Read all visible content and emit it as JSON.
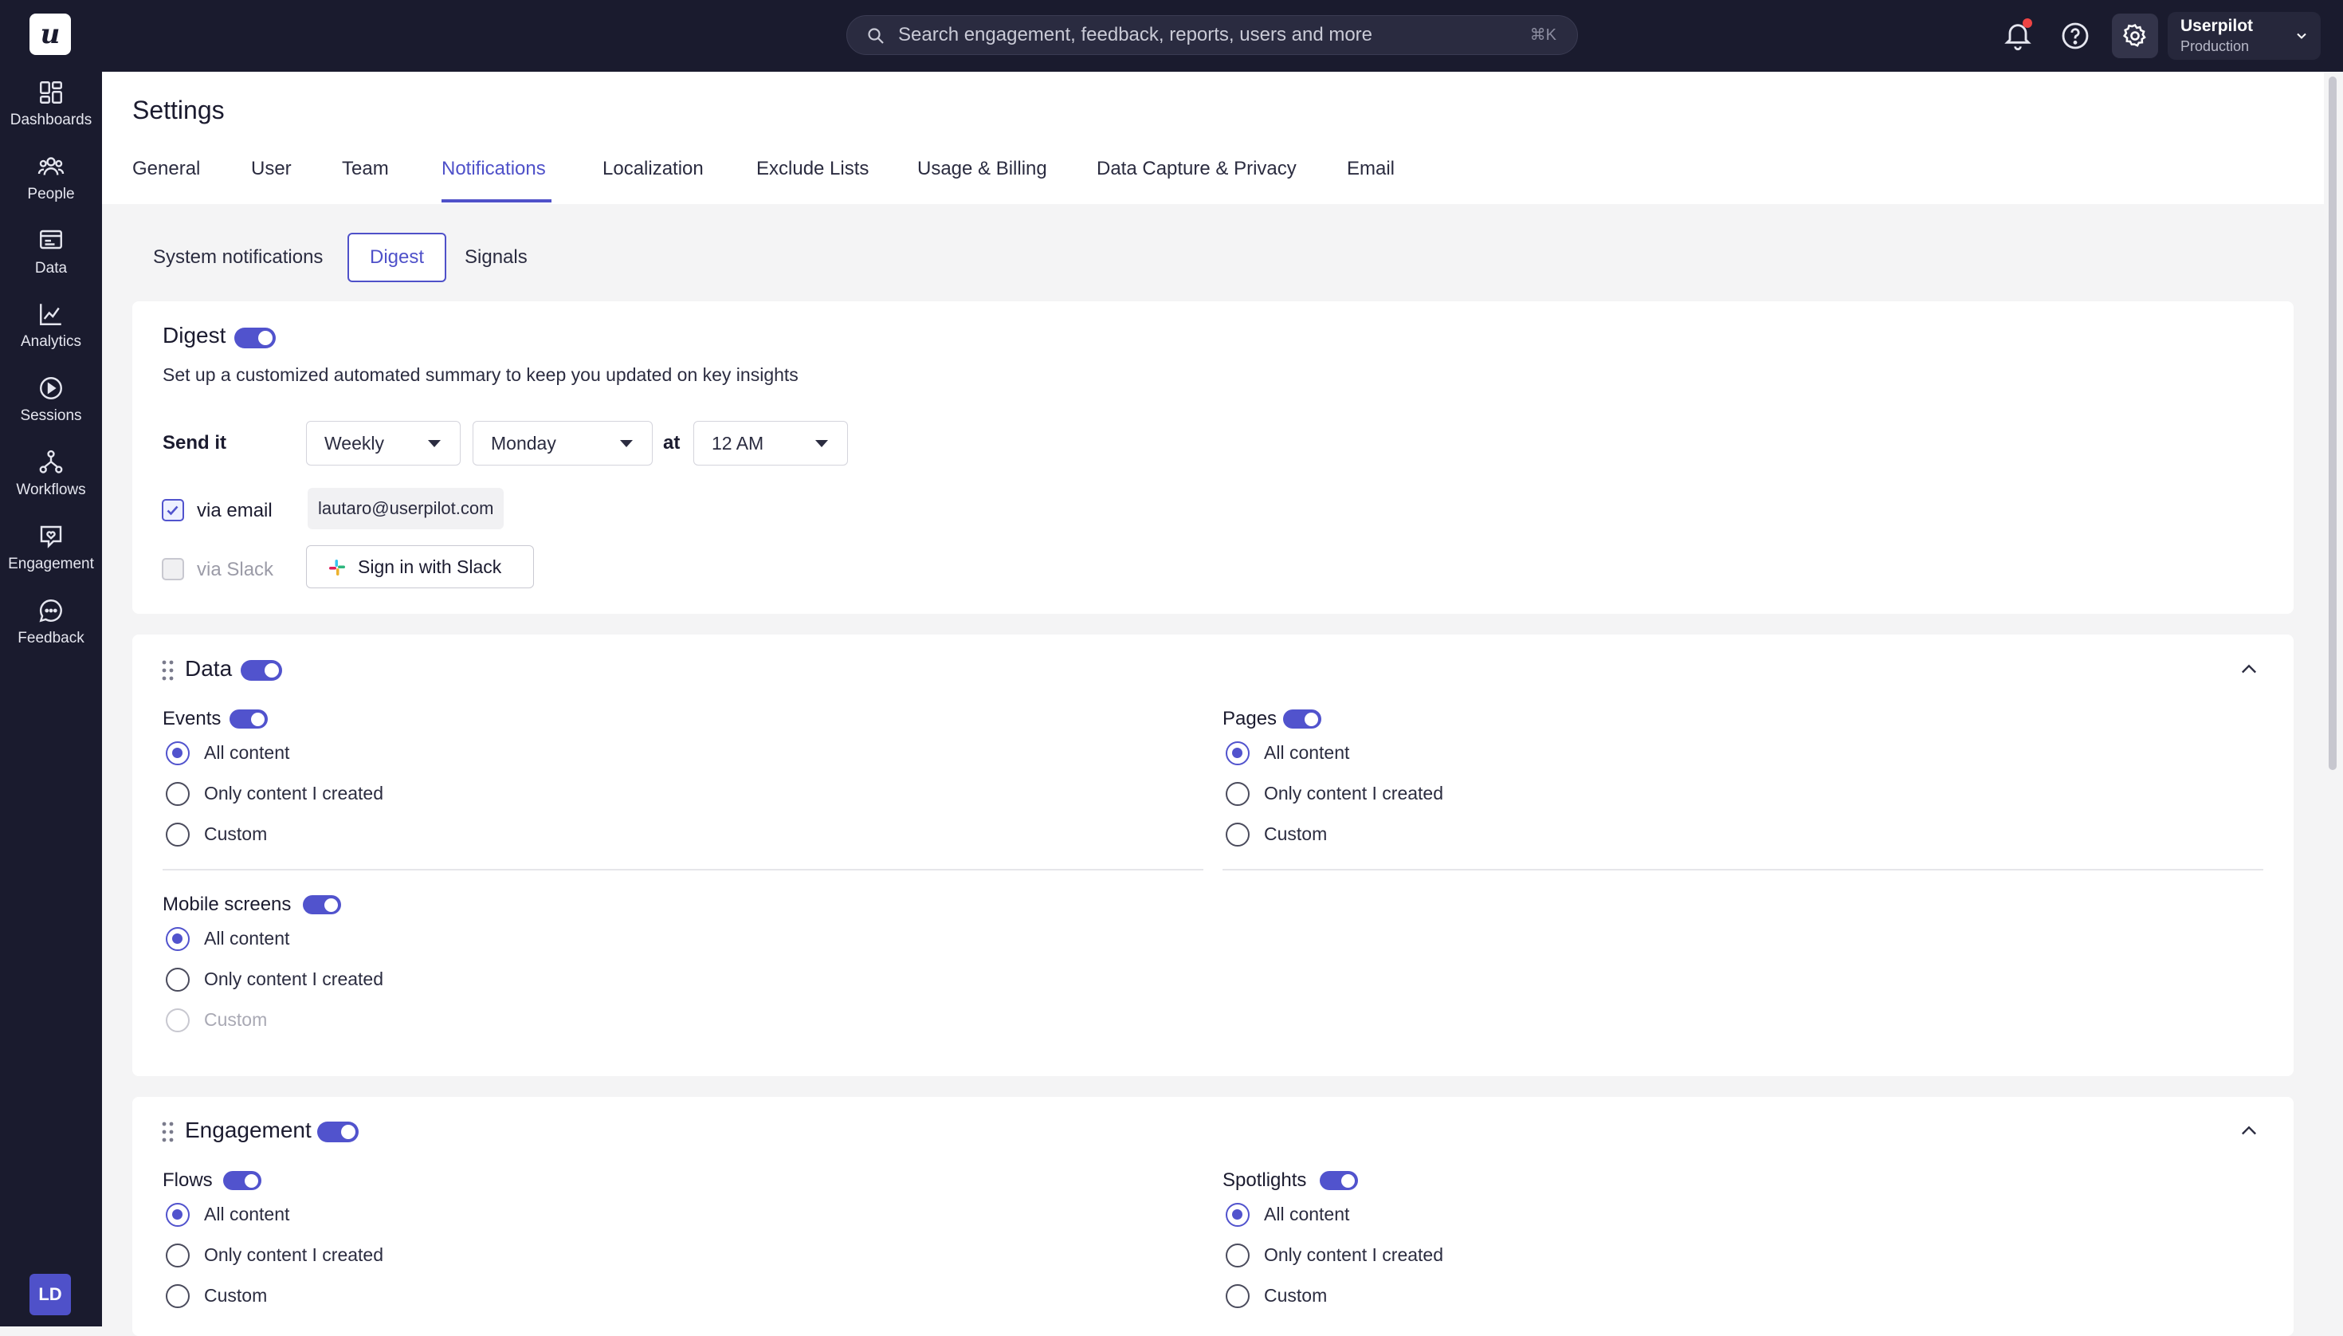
{
  "app": {
    "logo": "u"
  },
  "search": {
    "placeholder": "Search engagement, feedback, reports, users and more",
    "shortcut": "⌘K"
  },
  "account": {
    "name": "Userpilot",
    "env": "Production"
  },
  "user": {
    "initials": "LD"
  },
  "sidebar": {
    "items": [
      {
        "label": "Dashboards",
        "icon": "dashboard-icon"
      },
      {
        "label": "People",
        "icon": "people-icon"
      },
      {
        "label": "Data",
        "icon": "data-icon"
      },
      {
        "label": "Analytics",
        "icon": "analytics-icon"
      },
      {
        "label": "Sessions",
        "icon": "sessions-icon"
      },
      {
        "label": "Workflows",
        "icon": "workflows-icon"
      },
      {
        "label": "Engagement",
        "icon": "engagement-icon"
      },
      {
        "label": "Feedback",
        "icon": "feedback-icon"
      }
    ]
  },
  "page": {
    "title": "Settings"
  },
  "tabs": [
    "General",
    "User",
    "Team",
    "Notifications",
    "Localization",
    "Exclude Lists",
    "Usage & Billing",
    "Data Capture & Privacy",
    "Email"
  ],
  "active_tab": "Notifications",
  "subtabs": [
    "System notifications",
    "Digest",
    "Signals"
  ],
  "active_subtab": "Digest",
  "digest": {
    "title": "Digest",
    "description": "Set up a customized automated summary to keep you updated on key insights",
    "send_label": "Send it",
    "frequency": "Weekly",
    "day": "Monday",
    "at_label": "at",
    "time": "12 AM",
    "via_email": "via email",
    "email": "lautaro@userpilot.com",
    "via_slack": "via Slack",
    "slack_button": "Sign in with Slack"
  },
  "options": {
    "all": "All content",
    "mine": "Only content I created",
    "custom": "Custom"
  },
  "data_section": {
    "title": "Data",
    "events": "Events",
    "pages": "Pages",
    "mobile": "Mobile screens"
  },
  "engagement_section": {
    "title": "Engagement",
    "flows": "Flows",
    "spotlights": "Spotlights"
  },
  "colors": {
    "accent": "#5153cd",
    "sidebar_bg": "#1a1b2e",
    "alert": "#ef4444"
  }
}
